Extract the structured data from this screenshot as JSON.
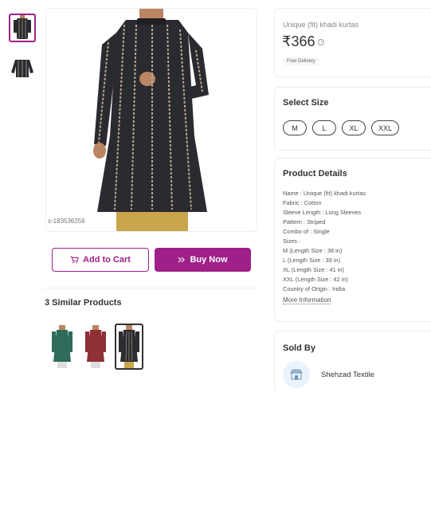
{
  "product": {
    "name": "Unique (fit) khadi kurtas",
    "price": "₹366",
    "free_delivery": "Free Delivery",
    "image_code": "s-183536256",
    "info_icon": "info-icon"
  },
  "actions": {
    "add_to_cart": "Add to Cart",
    "buy_now": "Buy Now",
    "cart_icon": "cart-icon",
    "buy_icon": "double-chevron-icon"
  },
  "similar": {
    "title": "3 Similar Products",
    "items": [
      {
        "color": "#2f6b5a"
      },
      {
        "color": "#8e3036"
      },
      {
        "color": "#2b2b30"
      }
    ]
  },
  "size": {
    "title": "Select Size",
    "options": [
      "M",
      "L",
      "XL",
      "XXL"
    ]
  },
  "details": {
    "title": "Product Details",
    "lines": [
      "Name : Unique (fit) khadi kurtas",
      "Fabric : Cotton",
      "Sleeve Length : Long Sleeves",
      "Pattern : Striped",
      "Combo of : Single",
      "Sizes :",
      "M (Length Size : 38 in)",
      "L (Length Size : 39 in)",
      "XL (Length Size : 41 in)",
      "XXL (Length Size : 42 in)",
      "Country of Origin : India"
    ],
    "more": "More Information"
  },
  "seller": {
    "title": "Sold By",
    "name": "Shehzad Textile",
    "icon": "store-icon"
  },
  "colors": {
    "accent": "#9f2089",
    "kurta": "#2a2a30",
    "stripe": "#b8a890",
    "skin": "#b98563",
    "pants": "#c9a54b"
  }
}
